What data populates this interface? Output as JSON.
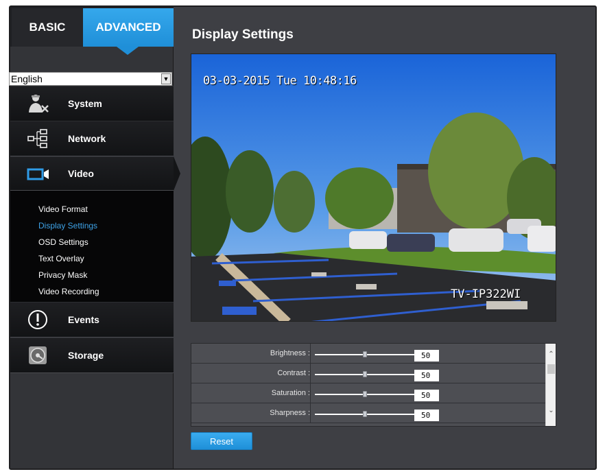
{
  "tabs": {
    "basic": "BASIC",
    "advanced": "ADVANCED"
  },
  "language": {
    "selected": "English"
  },
  "menu": {
    "system": "System",
    "network": "Network",
    "video": "Video",
    "events": "Events",
    "storage": "Storage"
  },
  "video_submenu": [
    {
      "label": "Video Format",
      "active": false
    },
    {
      "label": "Display Settings",
      "active": true
    },
    {
      "label": "OSD Settings",
      "active": false
    },
    {
      "label": "Text Overlay",
      "active": false
    },
    {
      "label": "Privacy Mask",
      "active": false
    },
    {
      "label": "Video Recording",
      "active": false
    }
  ],
  "main": {
    "title": "Display Settings",
    "osd_timestamp": "03-03-2015 Tue 10:48:16",
    "osd_camera_name": "TV-IP322WI"
  },
  "settings": [
    {
      "label": "Brightness :",
      "value": "50",
      "fraction": 0.5
    },
    {
      "label": "Contrast :",
      "value": "50",
      "fraction": 0.5
    },
    {
      "label": "Saturation :",
      "value": "50",
      "fraction": 0.5
    },
    {
      "label": "Sharpness :",
      "value": "50",
      "fraction": 0.5
    }
  ],
  "reset_label": "Reset",
  "colors": {
    "accent": "#1f8fd8",
    "active_submenu": "#3ea3e8",
    "panel": "#3e3f44"
  }
}
